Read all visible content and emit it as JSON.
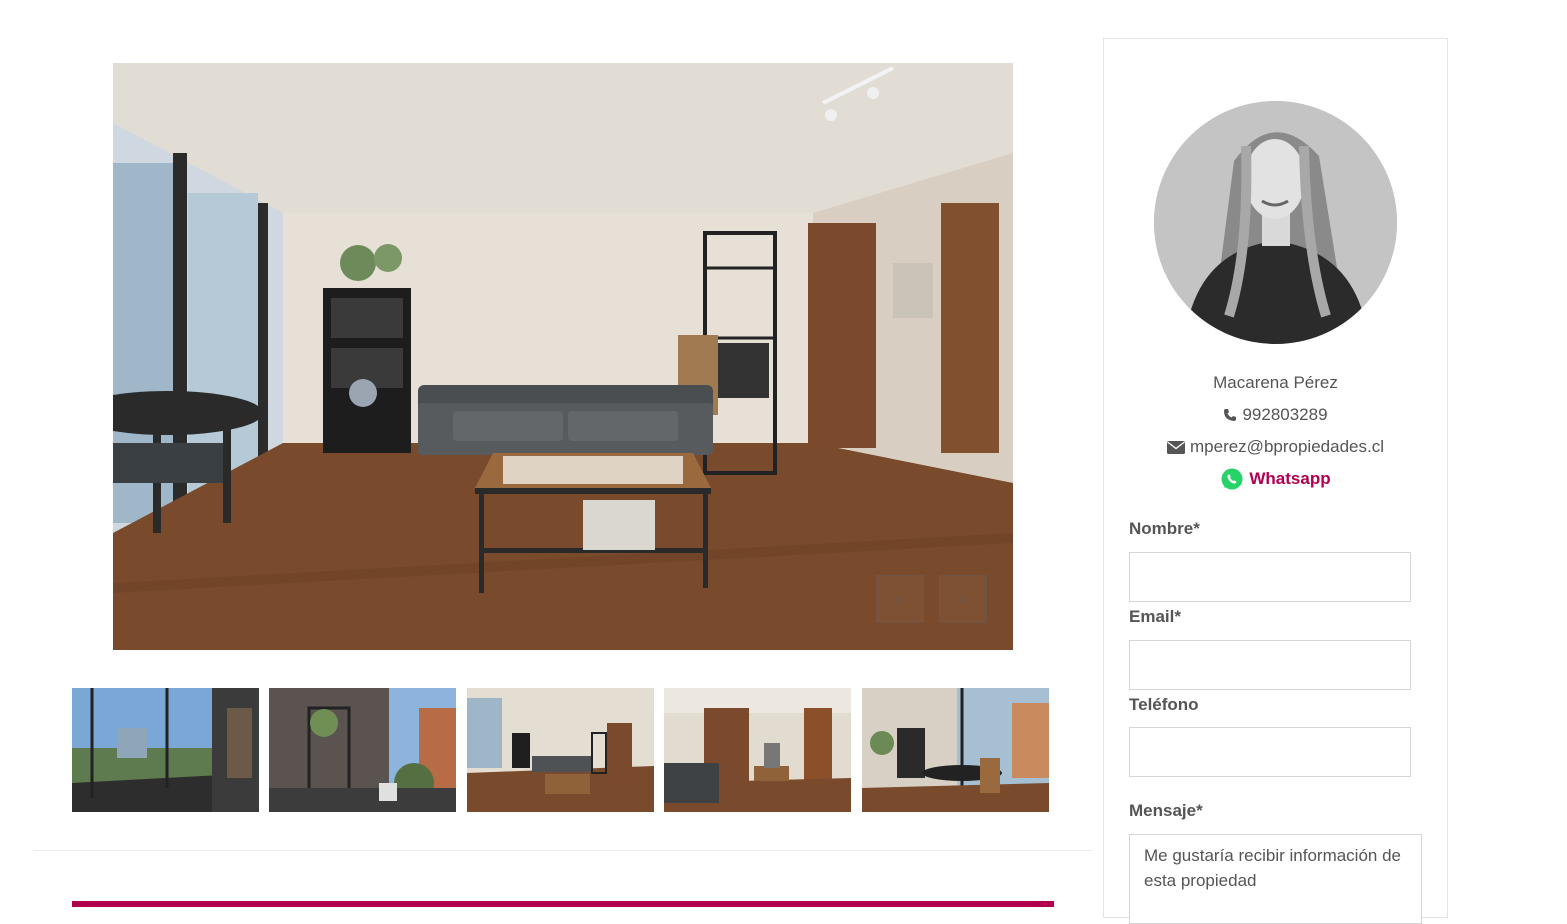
{
  "gallery": {
    "main_photo_alt": "",
    "prev_symbol": "‹",
    "next_symbol": "›",
    "thumbnail_count": 5
  },
  "agent": {
    "name": "Macarena Pérez",
    "phone": "992803289",
    "email": "mperez@bpropiedades.cl",
    "whatsapp_label": "Whatsapp"
  },
  "form": {
    "nombre_label": "Nombre*",
    "email_label": "Email*",
    "telefono_label": "Teléfono",
    "mensaje_label": "Mensaje*",
    "nombre_value": "",
    "email_value": "",
    "telefono_value": "",
    "mensaje_value": "Me gustaría recibir información de esta propiedad"
  },
  "colors": {
    "accent": "#b0004e",
    "whatsapp_green": "#25d366",
    "text": "#555555",
    "border": "#d6d6d6"
  },
  "icons": {
    "phone": "phone-icon",
    "email": "envelope-icon",
    "whatsapp": "whatsapp-icon",
    "prev": "chevron-left-icon",
    "next": "chevron-right-icon"
  }
}
